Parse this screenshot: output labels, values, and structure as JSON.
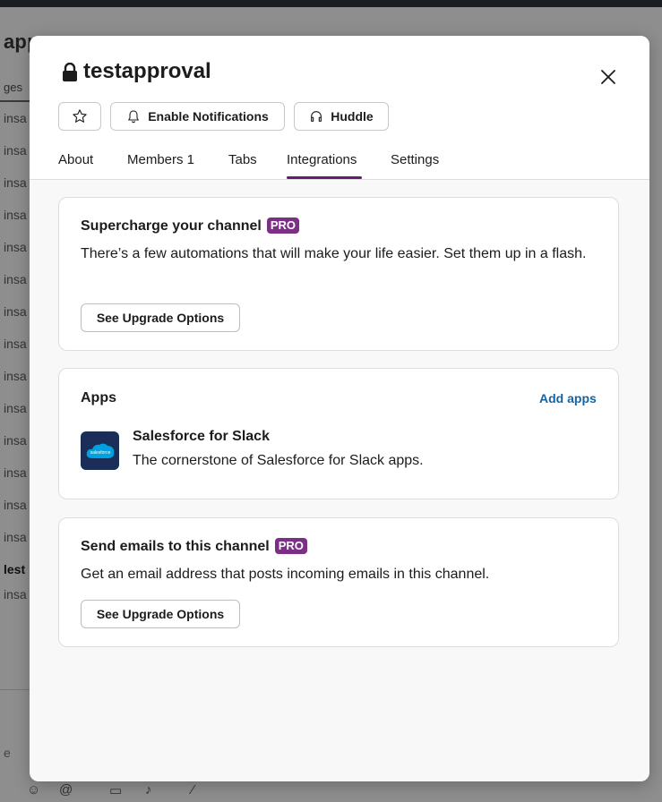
{
  "background": {
    "title": "appr",
    "subtab": "ges",
    "rows": [
      "insa",
      "insa",
      "insa",
      "insa",
      "insa",
      "insa",
      "insa",
      "insa",
      "insa",
      "insa",
      "insa",
      "insa",
      "insa",
      "insa",
      "insa"
    ],
    "bold_row": "lest",
    "input_hint": "e",
    "toolbar_icons": [
      "emoji-icon",
      "mention-icon",
      "video-icon",
      "mic-icon",
      "slash-command-icon"
    ]
  },
  "modal": {
    "channel_name": "testapproval",
    "private": true,
    "buttons": {
      "star_icon": "star-icon",
      "notifications_label": "Enable Notifications",
      "huddle_label": "Huddle"
    },
    "tabs": [
      {
        "label": "About"
      },
      {
        "label": "Members 1"
      },
      {
        "label": "Tabs"
      },
      {
        "label": "Integrations",
        "active": true
      },
      {
        "label": "Settings"
      }
    ],
    "supercharge": {
      "title": "Supercharge your channel",
      "badge": "PRO",
      "description": "There’s a few automations that will make your life easier. Set them up in a flash.",
      "button": "See Upgrade Options"
    },
    "apps": {
      "title": "Apps",
      "add_link": "Add apps",
      "items": [
        {
          "name": "Salesforce for Slack",
          "description": "The cornerstone of Salesforce for Slack apps.",
          "icon": "salesforce-logo",
          "icon_text": "salesforce"
        }
      ]
    },
    "email": {
      "title": "Send emails to this channel",
      "badge": "PRO",
      "description": "Get an email address that posts incoming emails in this channel.",
      "button": "See Upgrade Options"
    }
  },
  "colors": {
    "accent": "#611f69",
    "pro_badge": "#7c3085",
    "link": "#1264a3",
    "salesforce_blue": "#00a1e0"
  }
}
